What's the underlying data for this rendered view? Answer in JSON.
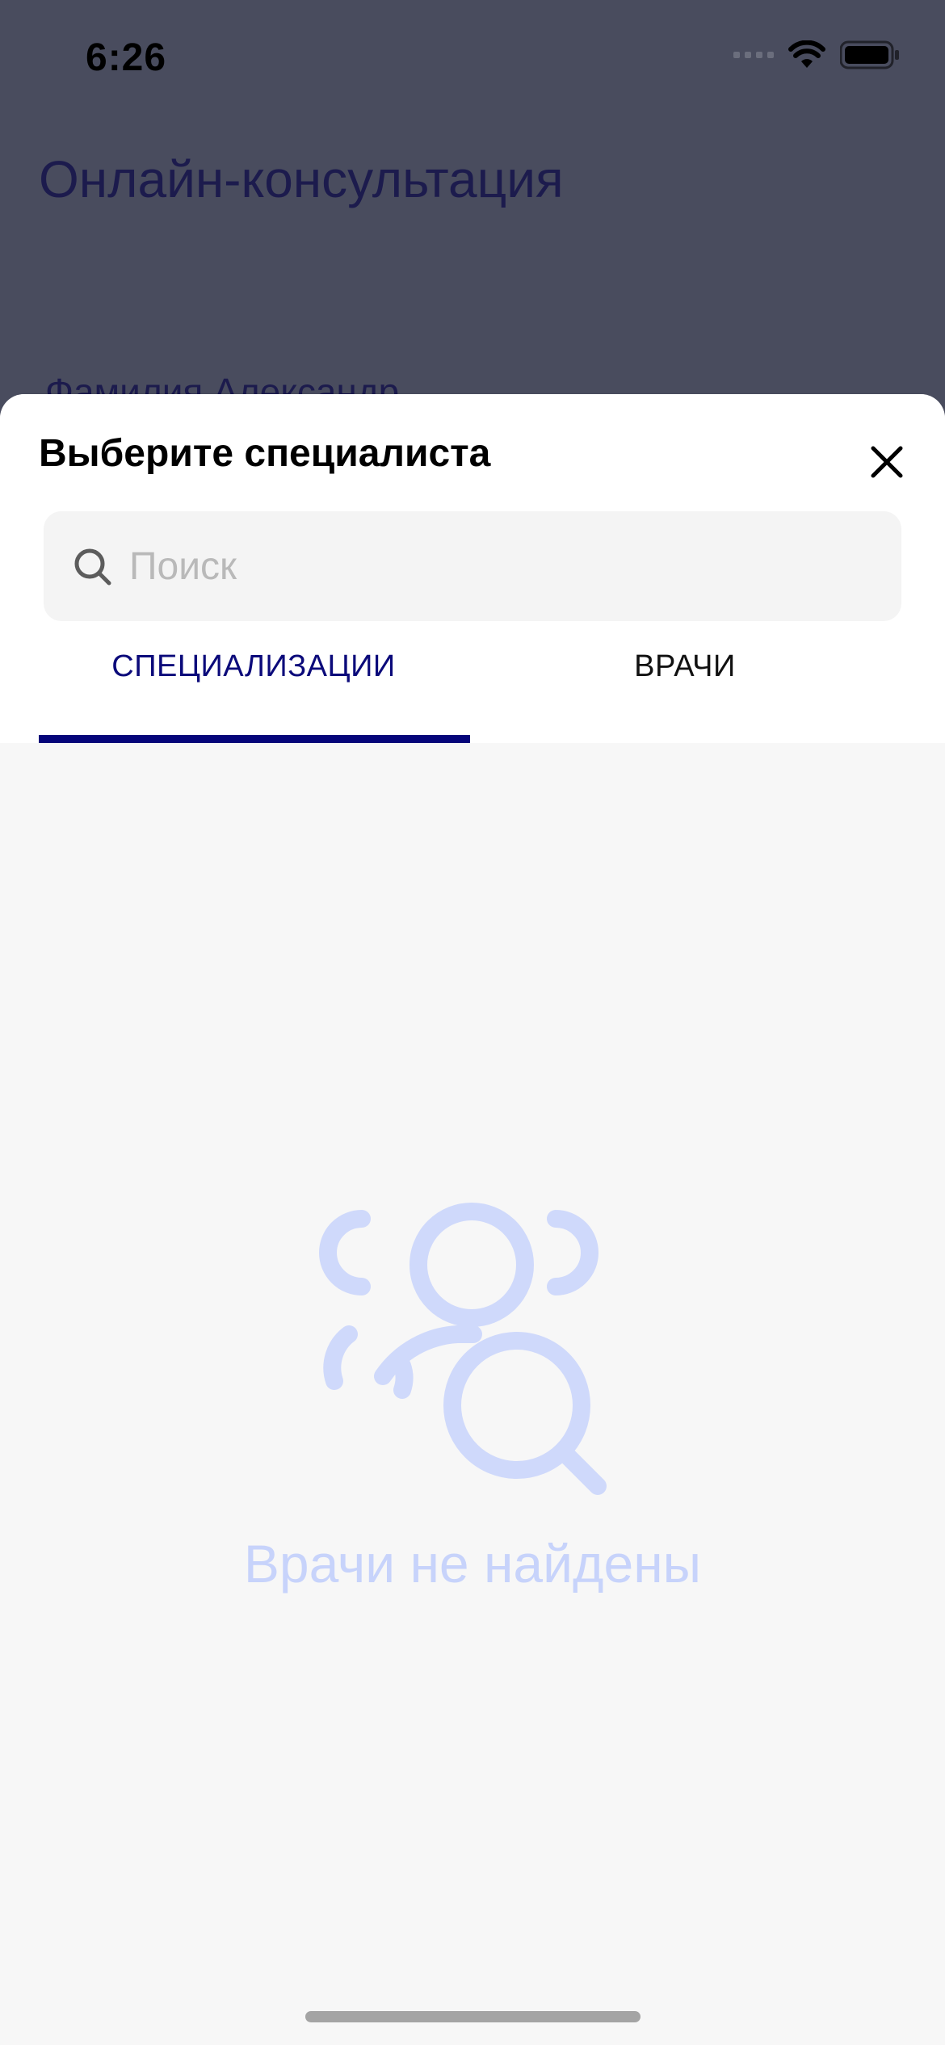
{
  "status_bar": {
    "time": "6:26"
  },
  "background_screen": {
    "title": "Онлайн-консультация",
    "name_field_value": "Фамилия Александр"
  },
  "sheet": {
    "title": "Выберите специалиста",
    "search": {
      "placeholder": "Поиск",
      "value": ""
    },
    "tabs": [
      {
        "label": "СПЕЦИАЛИЗАЦИИ",
        "active": true
      },
      {
        "label": "ВРАЧИ",
        "active": false
      }
    ],
    "empty_state": {
      "icon": "doctors-search-icon",
      "message": "Врачи не найдены"
    }
  },
  "colors": {
    "overlay": "#494c5e",
    "accent": "#05057a",
    "empty_state": "#c7d3fb",
    "sheet_background": "#f7f7f7"
  }
}
